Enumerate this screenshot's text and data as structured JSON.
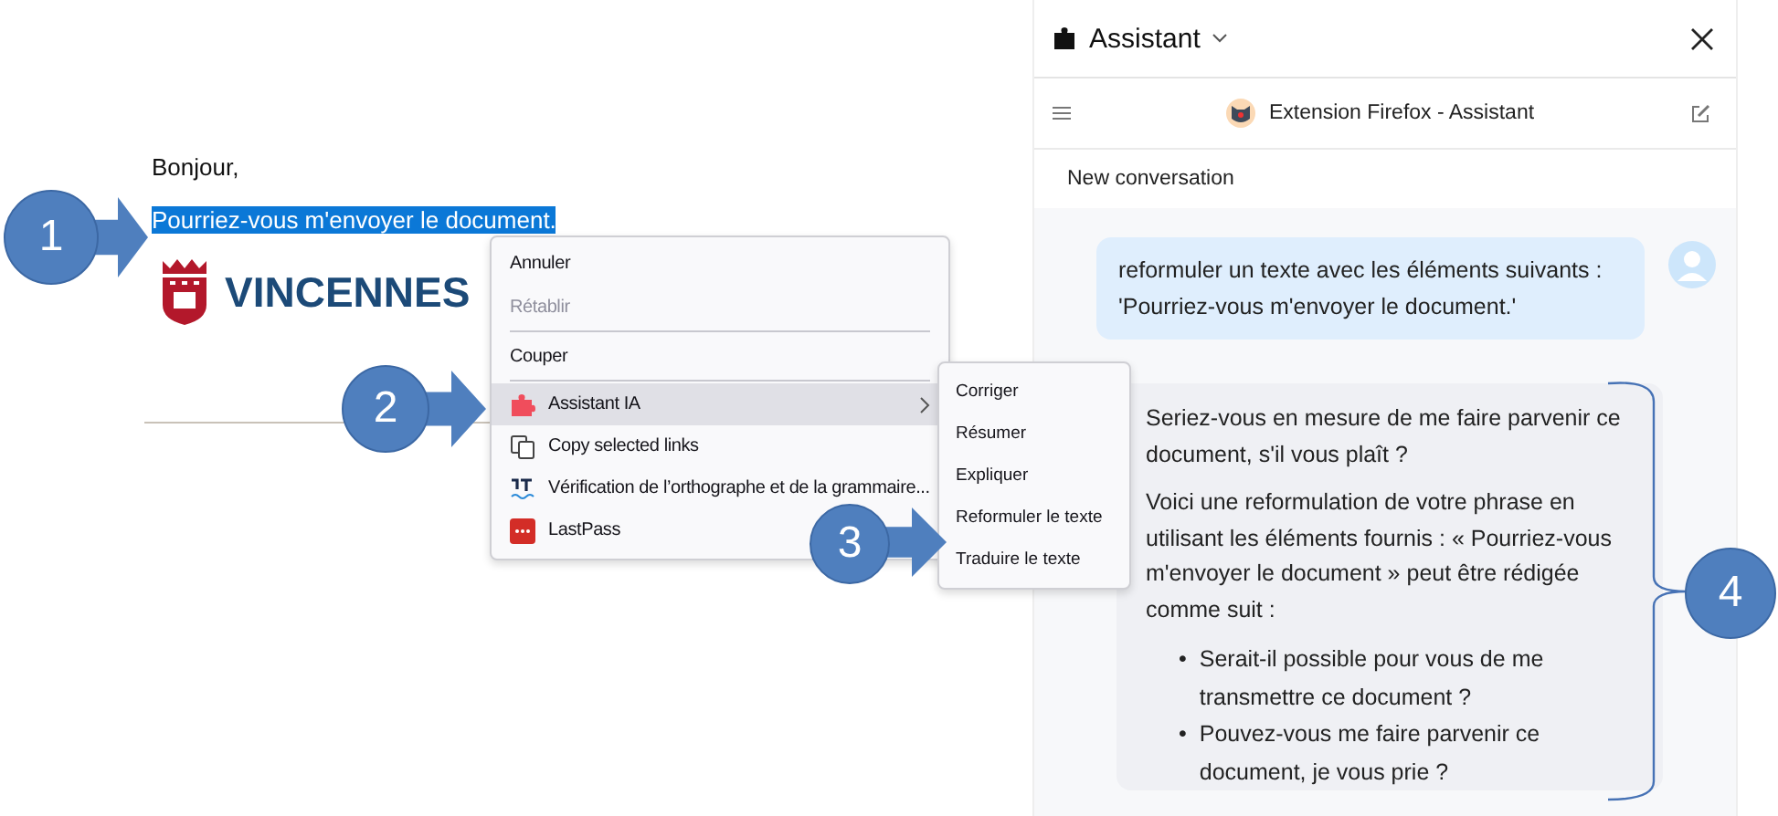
{
  "document": {
    "greeting": "Bonjour,",
    "selected_text": "Pourriez-vous m'envoyer le document.",
    "logo_text": "VINCENNES"
  },
  "context_menu": {
    "items": [
      {
        "label": "Annuler",
        "kind": "plain",
        "disabled": false,
        "selected": false
      },
      {
        "label": "Rétablir",
        "kind": "plain",
        "disabled": true,
        "selected": false
      },
      {
        "kind": "separator"
      },
      {
        "label": "Couper",
        "kind": "plain",
        "disabled": false,
        "selected": false
      },
      {
        "kind": "separator"
      },
      {
        "label": "Assistant IA",
        "kind": "submenu",
        "disabled": false,
        "selected": true
      },
      {
        "label": "Copy selected links",
        "kind": "extension",
        "disabled": false,
        "selected": false
      },
      {
        "label": "Vérification de l’orthographe et de la grammaire...",
        "kind": "extension",
        "disabled": false,
        "selected": false
      },
      {
        "label": "LastPass",
        "kind": "extension",
        "disabled": false,
        "selected": false
      }
    ]
  },
  "submenu": {
    "items": [
      {
        "label": "Corriger"
      },
      {
        "label": "Résumer"
      },
      {
        "label": "Expliquer"
      },
      {
        "label": "Reformuler le texte"
      },
      {
        "label": "Traduire le texte"
      }
    ]
  },
  "sidebar": {
    "title": "Assistant",
    "toolbar_title": "Extension Firefox - Assistant",
    "tab": "New conversation",
    "messages": [
      {
        "kind": "user",
        "paragraphs": [
          "reformuler un texte avec les éléments suivants : 'Pourriez-vous m'envoyer le document.'"
        ]
      },
      {
        "kind": "assistant",
        "paragraphs": [
          "Seriez-vous en mesure de me faire parvenir ce document, s'il vous plaît ?",
          "Voici une reformulation de votre phrase en utilisant les éléments fournis : « Pourriez-vous m'envoyer le document » peut être rédigée comme suit :"
        ],
        "bullets": [
          {
            "marker": "•",
            "text": "Serait-il possible pour vous de me transmettre ce document ?"
          },
          {
            "marker": "•",
            "text": "Pouvez-vous me faire parvenir ce document, je vous prie ?"
          }
        ]
      }
    ]
  },
  "callouts": [
    {
      "number": "1"
    },
    {
      "number": "2"
    },
    {
      "number": "3"
    },
    {
      "number": "4"
    }
  ]
}
